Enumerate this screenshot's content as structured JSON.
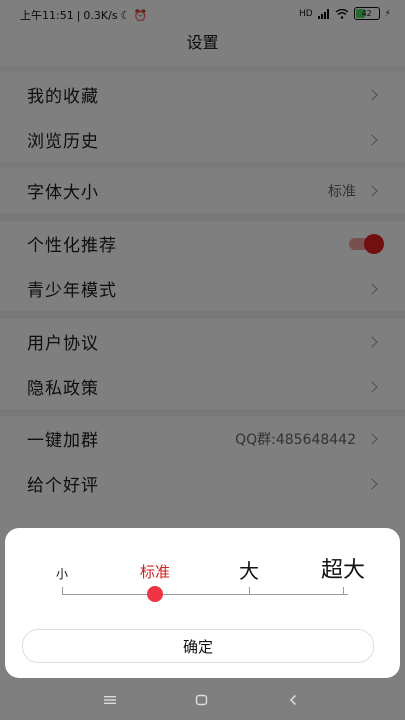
{
  "status_bar": {
    "time": "上午11:51",
    "speed": "0.3K/s",
    "signal_text": "HD",
    "battery": "42"
  },
  "header": {
    "title": "设置"
  },
  "groups": [
    {
      "items": [
        {
          "label": "我的收藏"
        },
        {
          "label": "浏览历史"
        }
      ]
    },
    {
      "items": [
        {
          "label": "字体大小",
          "value": "标准"
        }
      ]
    },
    {
      "items": [
        {
          "label": "个性化推荐",
          "toggle": true
        },
        {
          "label": "青少年模式"
        }
      ]
    },
    {
      "items": [
        {
          "label": "用户协议"
        },
        {
          "label": "隐私政策"
        }
      ]
    },
    {
      "items": [
        {
          "label": "一键加群",
          "value": "QQ群:485648442"
        },
        {
          "label": "给个好评"
        }
      ]
    }
  ],
  "font_sheet": {
    "options": [
      "小",
      "标准",
      "大",
      "超大"
    ],
    "selected": "标准",
    "selected_index": 1,
    "confirm_label": "确定",
    "accent_color": "#e02020"
  },
  "icons": {
    "moon": "moon-icon",
    "alarm_off": "alarm-off-icon",
    "wifi": "wifi-icon",
    "charging": "charging-icon",
    "menu": "menu-icon",
    "home": "home-icon",
    "back": "back-icon"
  }
}
